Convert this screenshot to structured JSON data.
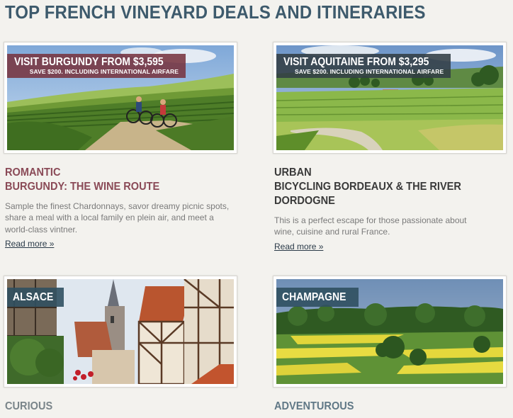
{
  "title": "TOP FRENCH VINEYARD DEALS AND ITINERARIES",
  "cards": [
    {
      "badge": "VISIT BURGUNDY FROM $3,595",
      "badge_sub": "SAVE $200. INCLUDING INTERNATIONAL AIRFARE",
      "category": "ROMANTIC",
      "name": "BURGUNDY: THE WINE ROUTE",
      "description": "Sample the finest Chardonnays, savor dreamy picnic spots, share a meal with a local family en plein air, and meet a world-class vintner.",
      "link": "Read more »"
    },
    {
      "badge": "VISIT AQUITAINE FROM $3,295",
      "badge_sub": "SAVE $200. INCLUDING INTERNATIONAL AIRFARE",
      "category": "URBAN",
      "name": "BICYCLING BORDEAUX & THE RIVER DORDOGNE",
      "description": "This is a perfect escape for those passionate about wine, cuisine and rural France.",
      "link": "Read more »"
    },
    {
      "badge": "ALSACE",
      "category": "CURIOUS"
    },
    {
      "badge": "CHAMPAGNE",
      "category": "ADVENTUROUS"
    }
  ],
  "colors": {
    "title": "#3d5a6c",
    "romantic": "#8a4a57",
    "urban": "#3a3a3a",
    "curious": "#7a858a",
    "adventurous": "#607886",
    "page_background": "#f3f2ee"
  }
}
